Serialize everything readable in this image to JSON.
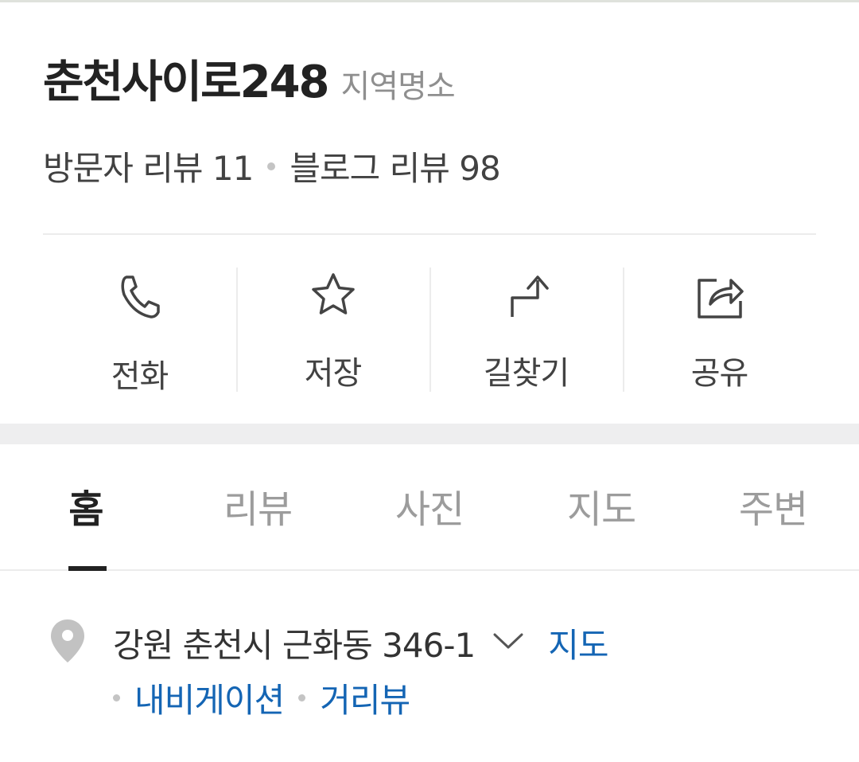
{
  "place": {
    "name": "춘천사이로248",
    "category": "지역명소",
    "visitor_reviews": "방문자 리뷰 11",
    "blog_reviews": "블로그 리뷰 98"
  },
  "actions": [
    {
      "label": "전화",
      "icon": "phone-icon"
    },
    {
      "label": "저장",
      "icon": "star-icon"
    },
    {
      "label": "길찾기",
      "icon": "directions-icon"
    },
    {
      "label": "공유",
      "icon": "share-icon"
    }
  ],
  "tabs": [
    {
      "label": "홈",
      "active": true
    },
    {
      "label": "리뷰",
      "active": false
    },
    {
      "label": "사진",
      "active": false
    },
    {
      "label": "지도",
      "active": false
    },
    {
      "label": "주변",
      "active": false
    }
  ],
  "address": {
    "text": "강원 춘천시 근화동 346-1",
    "map_link": "지도",
    "navigation_link": "내비게이션",
    "street_view_link": "거리뷰",
    "icon": "location-pin-icon"
  },
  "colors": {
    "link": "#1465b4",
    "text_primary": "#222222",
    "text_secondary": "#8f8f8f",
    "divider": "#ececec",
    "section_gap": "#eeeeef"
  }
}
